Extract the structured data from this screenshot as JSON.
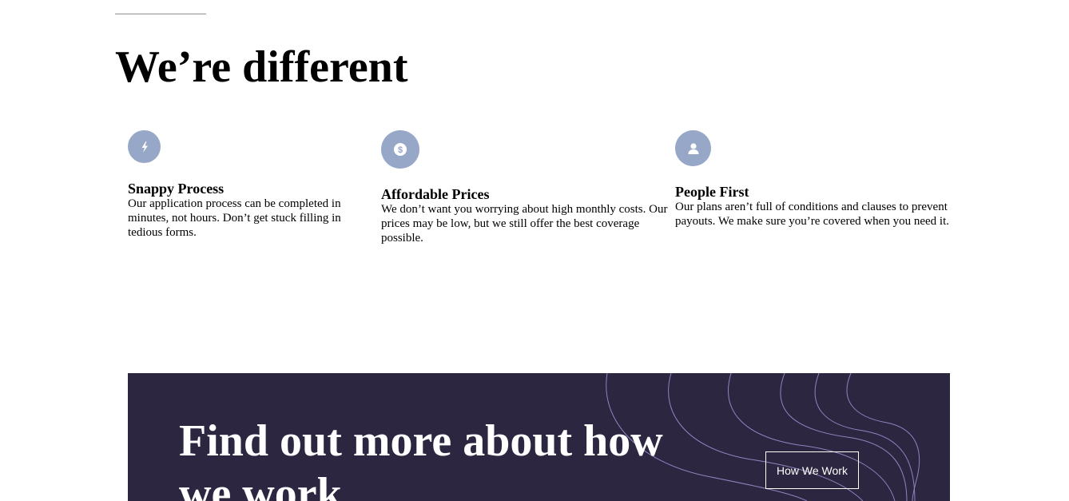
{
  "section": {
    "title": "We’re different"
  },
  "features": [
    {
      "icon": "lightning-icon",
      "title": "Snappy Process",
      "text": "Our application process can be completed in minutes, not hours. Don’t get stuck filling in tedious forms."
    },
    {
      "icon": "dollar-icon",
      "title": "Affordable Prices",
      "text": "We don’t want you worrying about high monthly costs. Our prices may be low, but we still offer the best coverage possible."
    },
    {
      "icon": "user-icon",
      "title": "People First",
      "text": "Our plans aren’t full of conditions and clauses to prevent payouts. We make sure you’re covered when you need it."
    }
  ],
  "cta": {
    "heading": "Find out more about how we work",
    "button_label": "How We Work"
  },
  "colors": {
    "icon_background": "#97a7c7",
    "cta_background": "#2c2640",
    "cta_lines": "#8d86bf"
  }
}
